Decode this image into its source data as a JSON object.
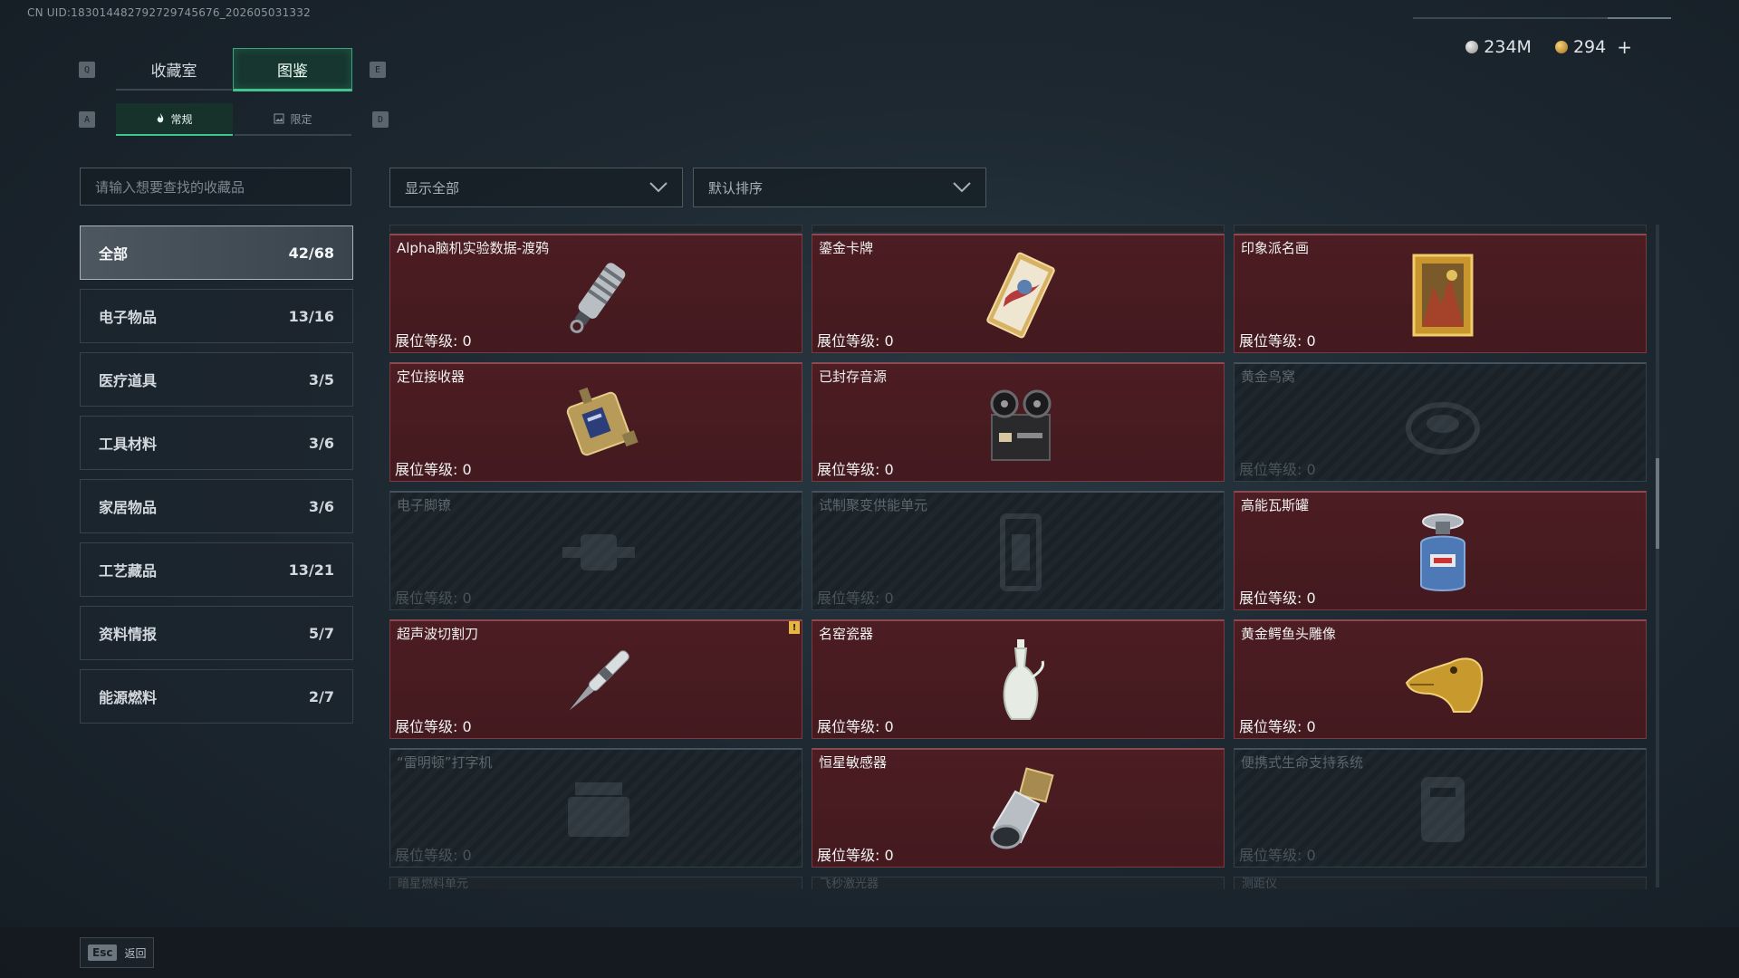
{
  "uid_text": "CN UID:18301448279272974567​6_202605031332",
  "currency": {
    "silver": "234M",
    "gold": "294",
    "plus": "+"
  },
  "keys": {
    "prev_tab": "Q",
    "next_tab": "E",
    "prev_sub": "A",
    "next_sub": "D",
    "back": "Esc"
  },
  "tabs": [
    "收藏室",
    "图鉴"
  ],
  "active_tab": 1,
  "subtabs": [
    "常规",
    "限定"
  ],
  "search": {
    "placeholder": "请输入想要查找的收藏品"
  },
  "filter": {
    "label": "显示全部"
  },
  "sort": {
    "label": "默认排序"
  },
  "categories": [
    {
      "name": "全部",
      "count": "42/68"
    },
    {
      "name": "电子物品",
      "count": "13/16"
    },
    {
      "name": "医疗道具",
      "count": "3/5"
    },
    {
      "name": "工具材料",
      "count": "3/6"
    },
    {
      "name": "家居物品",
      "count": "3/6"
    },
    {
      "name": "工艺藏品",
      "count": "13/21"
    },
    {
      "name": "资料情报",
      "count": "5/7"
    },
    {
      "name": "能源燃料",
      "count": "2/7"
    }
  ],
  "level_label": "展位等级:",
  "items": [
    {
      "name": "Alpha脑机实验数据-渡鸦",
      "level": "0",
      "owned": true,
      "icon": "data-drive-icon"
    },
    {
      "name": "鎏金卡牌",
      "level": "0",
      "owned": true,
      "icon": "gilded-card-icon"
    },
    {
      "name": "印象派名画",
      "level": "0",
      "owned": true,
      "icon": "framed-painting-icon"
    },
    {
      "name": "定位接收器",
      "level": "0",
      "owned": true,
      "icon": "receiver-icon"
    },
    {
      "name": "已封存音源",
      "level": "0",
      "owned": true,
      "icon": "reel-recorder-icon"
    },
    {
      "name": "黄金鸟窝",
      "level": "0",
      "owned": false,
      "icon": "bird-nest-icon"
    },
    {
      "name": "电子脚镣",
      "level": "0",
      "owned": false,
      "icon": "ankle-monitor-icon"
    },
    {
      "name": "试制聚变供能单元",
      "level": "0",
      "owned": false,
      "icon": "fusion-cell-icon"
    },
    {
      "name": "高能瓦斯罐",
      "level": "0",
      "owned": true,
      "icon": "gas-canister-icon"
    },
    {
      "name": "超声波切割刀",
      "level": "0",
      "owned": true,
      "icon": "ultrasonic-knife-icon",
      "badge": "!"
    },
    {
      "name": "名窑瓷器",
      "level": "0",
      "owned": true,
      "icon": "porcelain-vase-icon"
    },
    {
      "name": "黄金鳄鱼头雕像",
      "level": "0",
      "owned": true,
      "icon": "gold-crocodile-icon"
    },
    {
      "name": "“雷明顿”打字机",
      "level": "0",
      "owned": false,
      "icon": "typewriter-icon"
    },
    {
      "name": "恒星敏感器",
      "level": "0",
      "owned": true,
      "icon": "star-sensor-icon"
    },
    {
      "name": "便携式生命支持系统",
      "level": "0",
      "owned": false,
      "icon": "life-support-icon"
    }
  ],
  "partial_items": [
    "暗星燃料单元",
    "飞秒激光器",
    "测距仪"
  ],
  "footer": {
    "back_label": "返回"
  },
  "colors": {
    "accent": "#42c58c",
    "owned_card": "#4c1d22",
    "locked_card": "#1e272d",
    "badge": "#e7b642"
  }
}
